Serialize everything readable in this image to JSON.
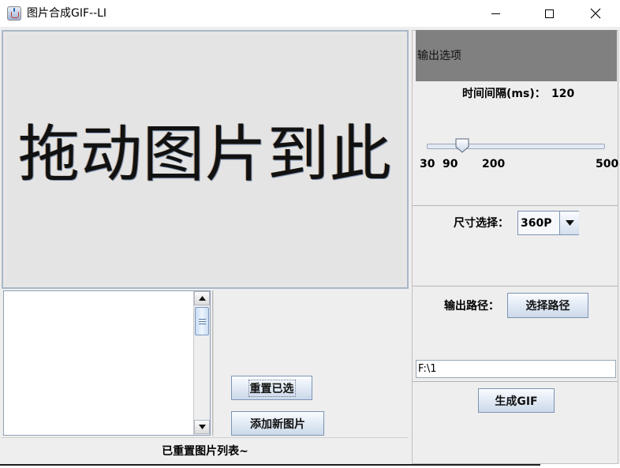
{
  "window": {
    "title": "图片合成GIF--LI",
    "icon": "java-cup-icon"
  },
  "drop_zone": {
    "hint": "拖动图片到此"
  },
  "list": {
    "scroll_up_icon": "arrow-up-icon",
    "scroll_down_icon": "arrow-down-icon"
  },
  "actions": {
    "reset_label": "重置已选",
    "add_label": "添加新图片"
  },
  "status": {
    "text": "已重置图片列表~"
  },
  "options": {
    "title": "输出选项",
    "interval_label": "时间间隔(ms)：",
    "interval_value": "120",
    "slider": {
      "min": 30,
      "max": 500,
      "value": 120,
      "ticks": [
        "30",
        "90",
        "200",
        "500"
      ]
    },
    "size_label": "尺寸选择：",
    "size_value": "360P",
    "path_label": "输出路径：",
    "choose_path_label": "选择路径",
    "path_value": "F:\\1",
    "generate_label": "生成GIF"
  },
  "colors": {
    "header_bg": "#808080",
    "panel_bg": "#eeeeee",
    "button_border": "#7d93b3"
  }
}
